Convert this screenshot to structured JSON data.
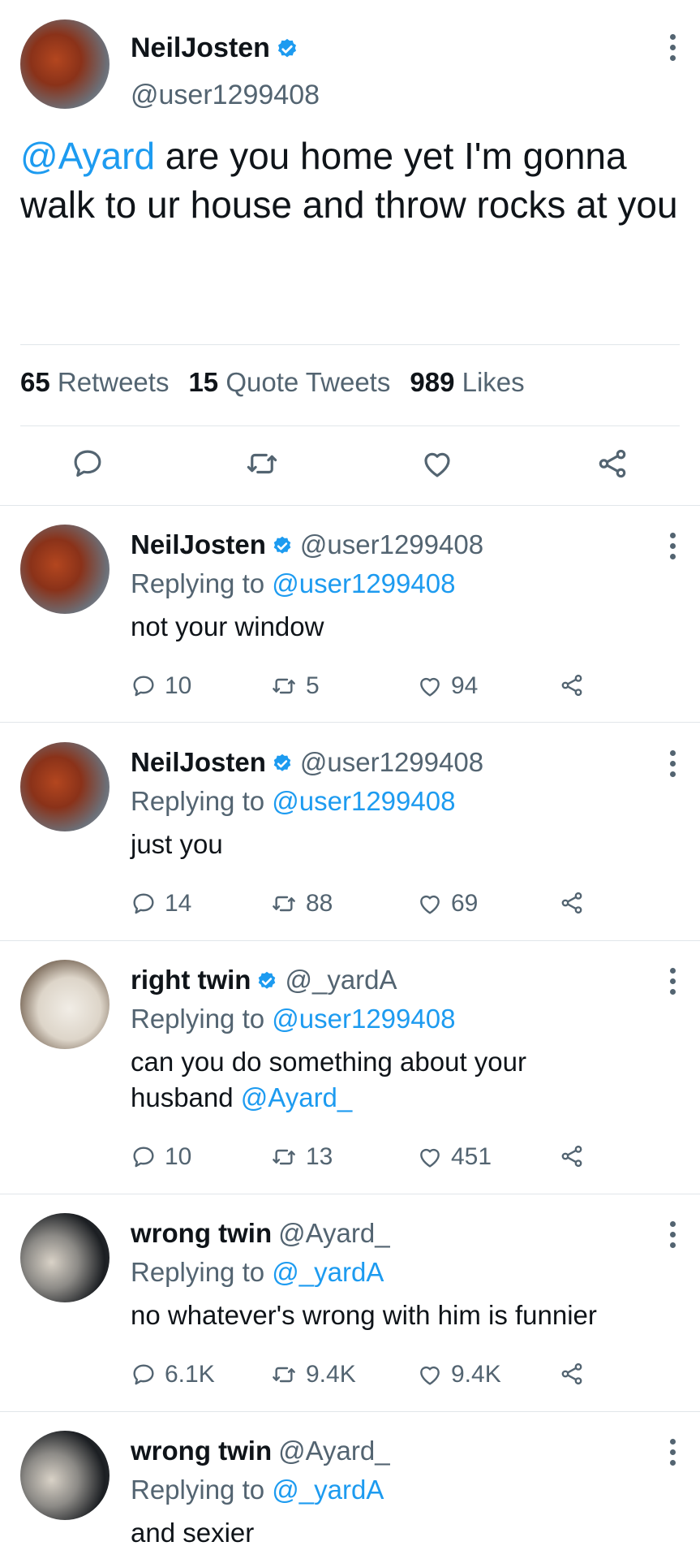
{
  "main_tweet": {
    "name": "NeilJosten",
    "handle": "@user1299408",
    "mention": "@Ayard",
    "text": " are you home yet I'm gonna walk to ur house and throw rocks at you",
    "retweets_count": "65",
    "retweets_label": "Retweets",
    "quotes_count": "15",
    "quotes_label": "Quote Tweets",
    "likes_count": "989",
    "likes_label": "Likes"
  },
  "replies": [
    {
      "name": "NeilJosten",
      "handle": "@user1299408",
      "replying_prefix": "Replying to ",
      "replying_to": "@user1299408",
      "text": "not your window",
      "text_mention": "",
      "comments": "10",
      "retweets": "5",
      "likes": "94"
    },
    {
      "name": "NeilJosten",
      "handle": "@user1299408",
      "replying_prefix": "Replying to ",
      "replying_to": "@user1299408",
      "text": "just you",
      "text_mention": "",
      "comments": "14",
      "retweets": "88",
      "likes": "69"
    },
    {
      "name": "right twin",
      "handle": "@_yardA",
      "replying_prefix": "Replying to ",
      "replying_to": "@user1299408",
      "text": "can you do something about your husband ",
      "text_mention": "@Ayard_",
      "comments": "10",
      "retweets": "13",
      "likes": "451"
    },
    {
      "name": "wrong twin",
      "handle": "@Ayard_",
      "replying_prefix": "Replying to ",
      "replying_to": "@_yardA",
      "text": "no whatever's wrong with him is funnier",
      "text_mention": "",
      "comments": "6.1K",
      "retweets": "9.4K",
      "likes": "9.4K"
    },
    {
      "name": "wrong twin",
      "handle": "@Ayard_",
      "replying_prefix": "Replying to ",
      "replying_to": "@_yardA",
      "text": "and sexier",
      "text_mention": ""
    }
  ],
  "colors": {
    "accent": "#1d9bf0",
    "text_primary": "#0f1419",
    "text_secondary": "#536471",
    "divider": "#e1e6ea"
  },
  "icons": [
    "verified-badge-icon",
    "more-icon",
    "reply-icon",
    "retweet-icon",
    "like-icon",
    "share-icon"
  ]
}
